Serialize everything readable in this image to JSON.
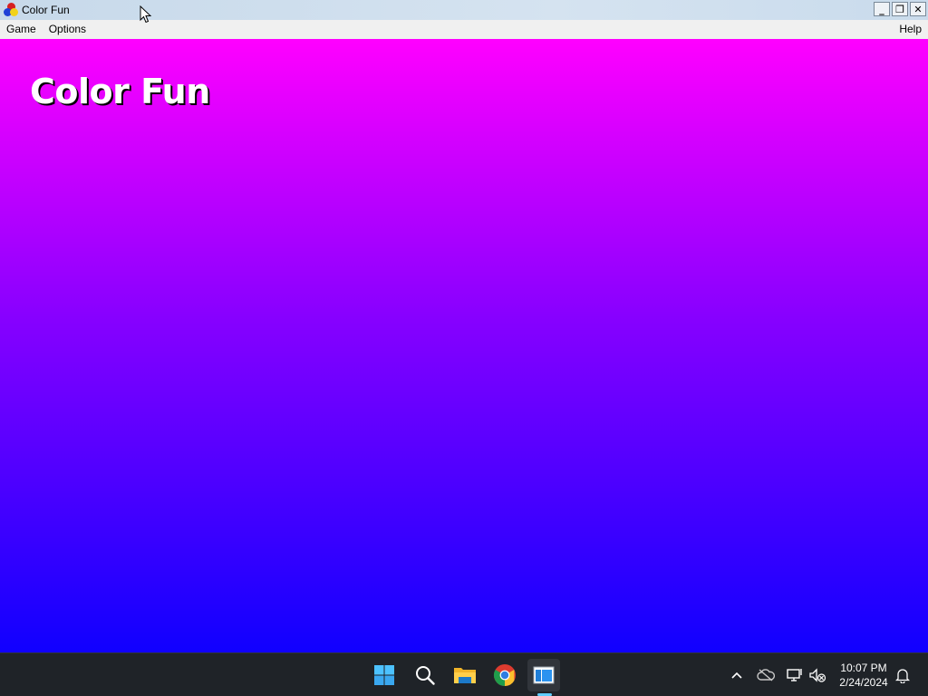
{
  "window": {
    "title": "Color Fun",
    "icon": "color-fun-app-icon",
    "controls": {
      "minimize_label": "_",
      "restore_label": "❐",
      "close_label": "✕"
    }
  },
  "menubar": {
    "items": [
      {
        "label": "Game"
      },
      {
        "label": "Options"
      }
    ],
    "help_label": "Help"
  },
  "canvas": {
    "heading": "Color Fun",
    "gradient_top_color": "#ff00ff",
    "gradient_mid_color": "#8800ff",
    "gradient_bottom_color": "#1000ff"
  },
  "taskbar": {
    "icons": [
      "windows-start-icon",
      "search-icon",
      "file-explorer-icon",
      "chrome-icon",
      "color-fun-taskbar-icon"
    ],
    "accent_color": "#60cdff",
    "tray_icons": [
      "chevron-up-icon",
      "onedrive-offline-icon",
      "network-icon",
      "volume-muted-icon",
      "notification-bell-icon"
    ],
    "clock": {
      "time": "10:07 PM",
      "date": "2/24/2024"
    }
  }
}
